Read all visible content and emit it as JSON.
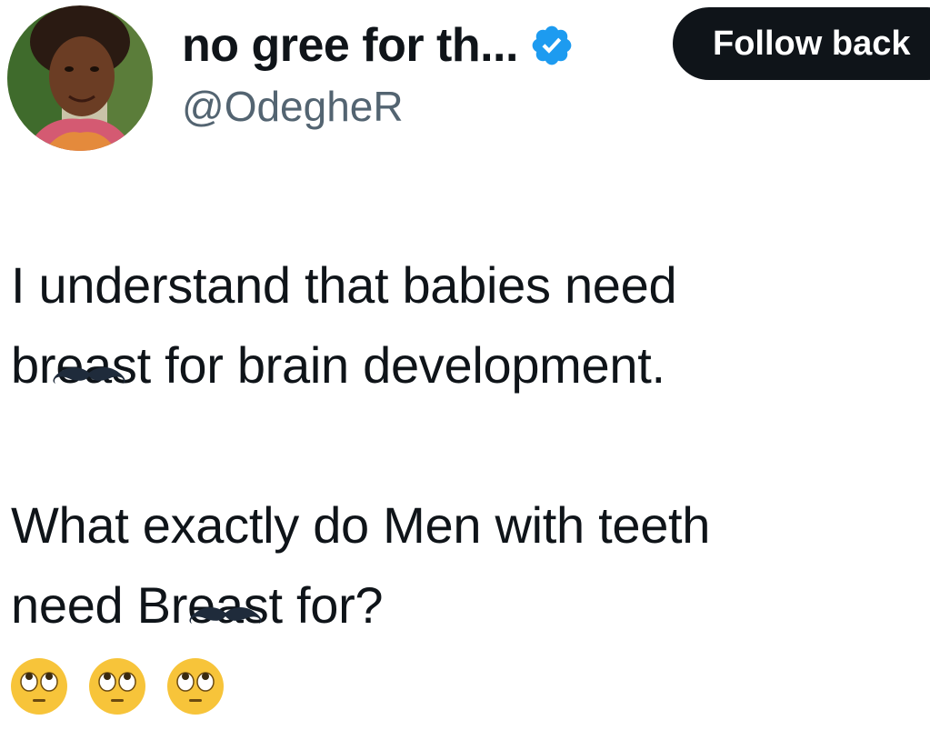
{
  "author": {
    "display_name": "no gree for th...",
    "handle": "@OdegheR",
    "verified": true,
    "avatar_icon": "profile-photo"
  },
  "follow_button": {
    "label": "Follow back"
  },
  "tweet": {
    "line1": "I understand that babies need",
    "line2_prefix": "br",
    "line2_redacted": "ea",
    "line2_suffix": "st for brain development.",
    "line3": "What exactly do Men with teeth",
    "line4_prefix": "need Br",
    "line4_redacted": "ea",
    "line4_suffix": "st for?",
    "emojis": [
      "face-with-rolling-eyes",
      "face-with-rolling-eyes",
      "face-with-rolling-eyes"
    ]
  },
  "colors": {
    "text": "#0f1419",
    "secondary_text": "#536471",
    "verified_blue": "#1d9bf0",
    "button_bg": "#0f1419",
    "button_text": "#ffffff"
  }
}
